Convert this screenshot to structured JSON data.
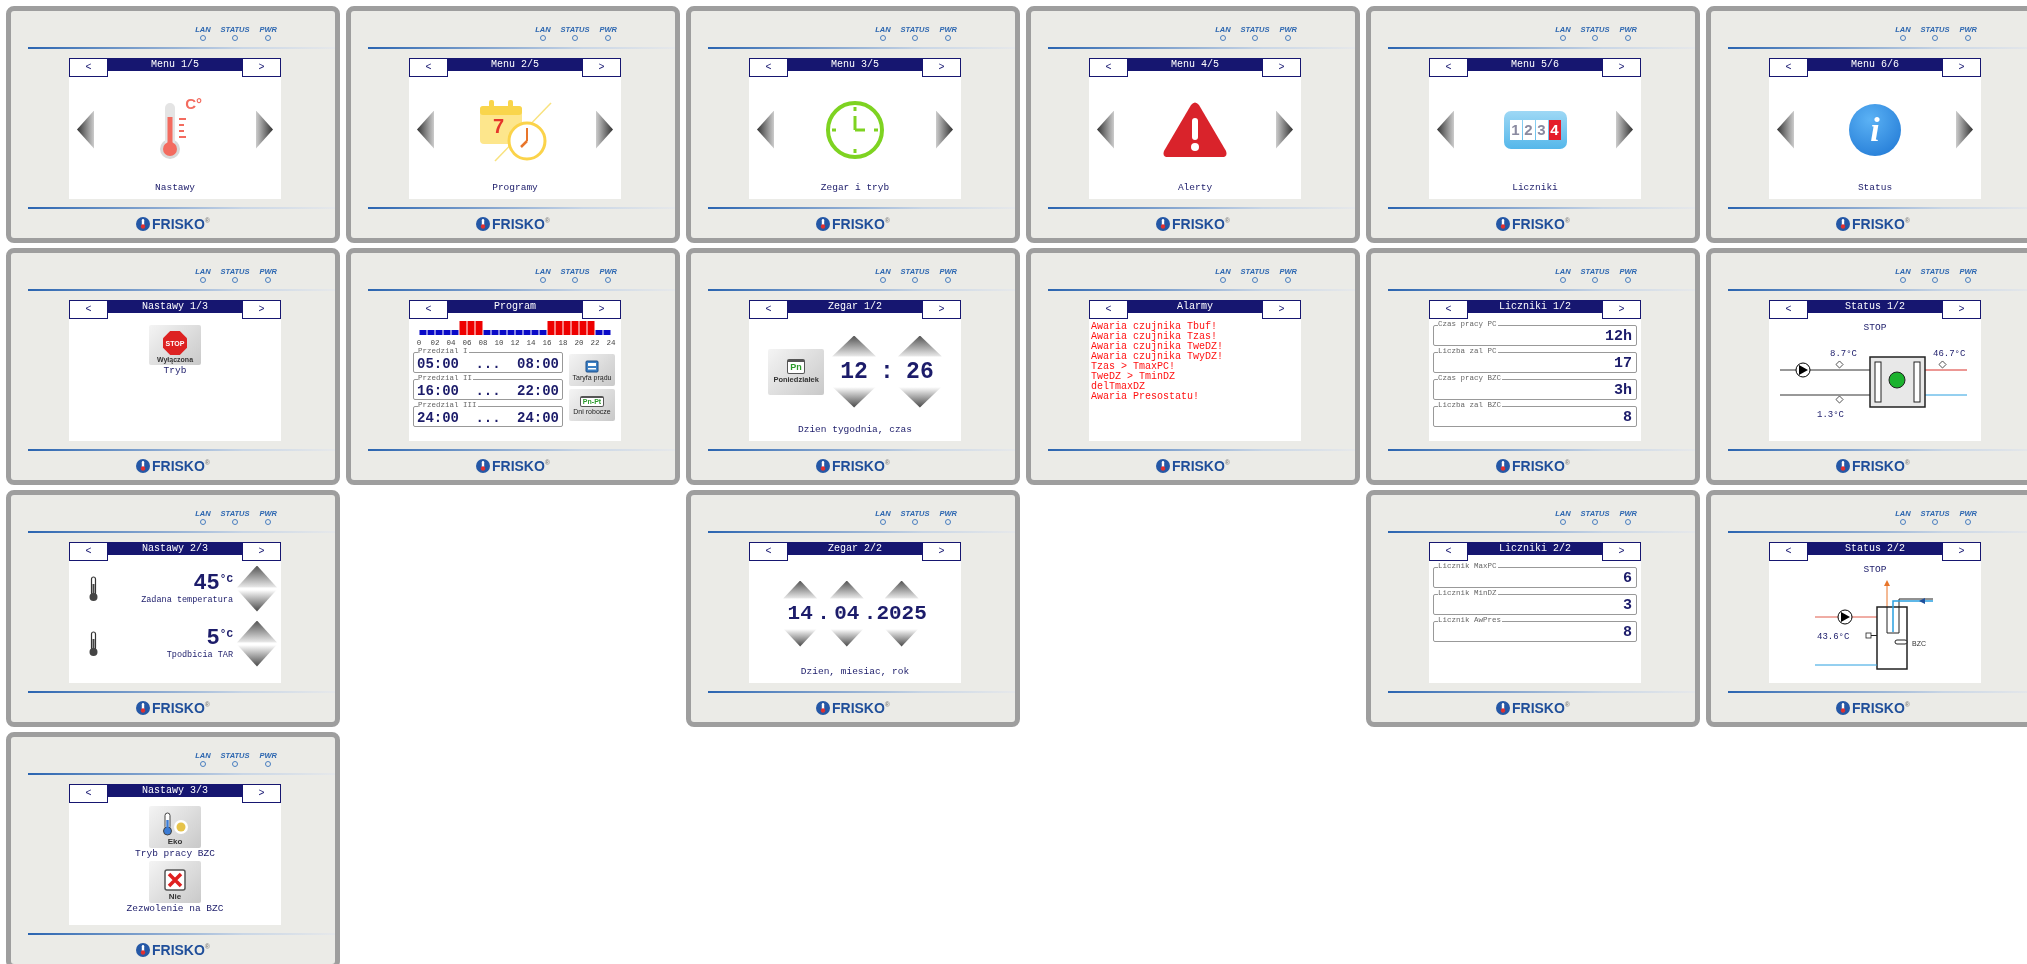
{
  "columns": [
    {
      "panels": [
        {
          "kind": "menu",
          "title": "Menu 1/5",
          "label": "Nastawy",
          "icon_text": "C°",
          "leds": [
            "LAN",
            "STATUS",
            "PWR"
          ],
          "prev": "<",
          "next": ">",
          "logo": "FRISKO$^{®}$"
        },
        {
          "kind": "mode",
          "title": "Nastawy 1/3",
          "sign": "STOP",
          "state": "Wyłączona",
          "caption": "Tryb",
          "leds": [
            "LAN",
            "STATUS",
            "PWR"
          ],
          "prev": "<",
          "next": ">",
          "logo": "FRISKO$^{®}$"
        },
        {
          "kind": "temps",
          "title": "Nastawy 2/3",
          "items": [
            {
              "value": "45",
              "unit": "°C",
              "label": "Zadana temperatura"
            },
            {
              "value": "5",
              "unit": "°C",
              "label": "Tpodbicia TAR"
            }
          ],
          "leds": [
            "LAN",
            "STATUS",
            "PWR"
          ],
          "prev": "<",
          "next": ">",
          "logo": "FRISKO$^{®}$"
        },
        {
          "kind": "bzc",
          "title": "Nastawy 3/3",
          "items": [
            {
              "kind": "eco",
              "state": "Eko",
              "caption": "Tryb pracy BZC"
            },
            {
              "kind": "deny",
              "state": "Nie",
              "caption": "Zezwolenie na BZC"
            }
          ],
          "leds": [
            "LAN",
            "STATUS",
            "PWR"
          ],
          "prev": "<",
          "next": ">",
          "logo": "FRISKO$^{®}$"
        }
      ]
    },
    {
      "panels": [
        {
          "kind": "menu",
          "title": "Menu 2/5",
          "label": "Programy",
          "icon_text": "7",
          "leds": [
            "LAN",
            "STATUS",
            "PWR"
          ],
          "prev": "<",
          "next": ">",
          "logo": "FRISKO$^{®}$"
        },
        {
          "kind": "program",
          "title": "Program",
          "hour_labels": [
            "0",
            "02",
            "04",
            "06",
            "08",
            "10",
            "12",
            "14",
            "16",
            "18",
            "20",
            "22",
            "24"
          ],
          "ranges": [
            {
              "label": "Przedzial I",
              "start": "05:00",
              "separator": "...",
              "end": "08:00"
            },
            {
              "label": "Przedzial II",
              "start": "16:00",
              "separator": "...",
              "end": "22:00"
            },
            {
              "label": "Przedzial III",
              "start": "24:00",
              "separator": "...",
              "end": "24:00"
            }
          ],
          "buttons": [
            {
              "kind": "meter",
              "label": "Taryfa prądu"
            },
            {
              "kind": "calendar",
              "icon_text": "Pn-Pt",
              "label": "Dni robocze"
            }
          ],
          "leds": [
            "LAN",
            "STATUS",
            "PWR"
          ],
          "prev": "<",
          "next": ">",
          "logo": "FRISKO$^{®}$"
        }
      ]
    },
    {
      "panels": [
        {
          "kind": "menu",
          "title": "Menu 3/5",
          "label": "Zegar i tryb",
          "leds": [
            "LAN",
            "STATUS",
            "PWR"
          ],
          "prev": "<",
          "next": ">",
          "logo": "FRISKO$^{®}$"
        },
        {
          "kind": "clock",
          "title": "Zegar 1/2",
          "day_badge": "Pn",
          "day": "Poniedziałek",
          "hours": "12",
          "colon": ":",
          "minutes": "26",
          "caption": "Dzien tygodnia, czas",
          "leds": [
            "LAN",
            "STATUS",
            "PWR"
          ],
          "prev": "<",
          "next": ">",
          "logo": "FRISKO$^{®}$"
        },
        {
          "kind": "date",
          "title": "Zegar 2/2",
          "fields": [
            "14",
            "04",
            "2025"
          ],
          "separators": [
            ".",
            "."
          ],
          "caption": "Dzien, miesiac, rok",
          "leds": [
            "LAN",
            "STATUS",
            "PWR"
          ],
          "prev": "<",
          "next": ">",
          "logo": "FRISKO$^{®}$"
        }
      ]
    },
    {
      "panels": [
        {
          "kind": "menu",
          "title": "Menu 4/5",
          "label": "Alerty",
          "leds": [
            "LAN",
            "STATUS",
            "PWR"
          ],
          "prev": "<",
          "next": ">",
          "logo": "FRISKO$^{®}$"
        },
        {
          "kind": "alarms",
          "title": "Alarmy",
          "lines": [
            "Awaria czujnika Tbuf!",
            "Awaria czujnika Tzas!",
            "Awaria czujnika TweDZ!",
            "Awaria czujnika TwyDZ!",
            "Tzas > TmaxPC!",
            "TweDZ > TminDZ",
            "delTmaxDZ",
            "Awaria Presostatu!"
          ],
          "leds": [
            "LAN",
            "STATUS",
            "PWR"
          ],
          "prev": "<",
          "next": ">",
          "logo": "FRISKO$^{®}$"
        }
      ]
    },
    {
      "panels": [
        {
          "kind": "menu",
          "title": "Menu 5/6",
          "label": "Liczniki",
          "icon_digits": [
            "1",
            "2",
            "3",
            "4"
          ],
          "leds": [
            "LAN",
            "STATUS",
            "PWR"
          ],
          "prev": "<",
          "next": ">",
          "logo": "FRISKO$^{®}$"
        },
        {
          "kind": "counters",
          "title": "Liczniki 1/2",
          "items": [
            {
              "label": "Czas pracy PC",
              "value": "12h"
            },
            {
              "label": "Liczba zal PC",
              "value": "17"
            },
            {
              "label": "Czas pracy BZC",
              "value": "3h"
            },
            {
              "label": "Liczba zal BZC",
              "value": "8"
            }
          ],
          "leds": [
            "LAN",
            "STATUS",
            "PWR"
          ],
          "prev": "<",
          "next": ">",
          "logo": "FRISKO$^{®}$"
        },
        {
          "kind": "counters",
          "title": "Liczniki 2/2",
          "items": [
            {
              "label": "Licznik MaxPC",
              "value": "6"
            },
            {
              "label": "Licznik MinDZ",
              "value": "3"
            },
            {
              "label": "Licznik AwPres",
              "value": "8"
            }
          ],
          "leds": [
            "LAN",
            "STATUS",
            "PWR"
          ],
          "prev": "<",
          "next": ">",
          "logo": "FRISKO$^{®}$"
        }
      ]
    },
    {
      "panels": [
        {
          "kind": "menu",
          "title": "Menu 6/6",
          "label": "Status",
          "icon_text": "i",
          "leds": [
            "LAN",
            "STATUS",
            "PWR"
          ],
          "prev": "<",
          "next": ">",
          "logo": "FRISKO$^{®}$"
        },
        {
          "kind": "status_unit",
          "title": "Status 1/2",
          "state": "STOP",
          "readings": [
            "8.7°C",
            "46.7°C",
            "1.3°C"
          ],
          "leds": [
            "LAN",
            "STATUS",
            "PWR"
          ],
          "prev": "<",
          "next": ">",
          "logo": "FRISKO$^{®}$"
        },
        {
          "kind": "status_tank",
          "title": "Status 2/2",
          "state": "STOP",
          "reading": "43.6°C",
          "tank_label": "BZC",
          "leds": [
            "LAN",
            "STATUS",
            "PWR"
          ],
          "prev": "<",
          "next": ">",
          "logo": "FRISKO$^{®}$"
        }
      ]
    }
  ]
}
